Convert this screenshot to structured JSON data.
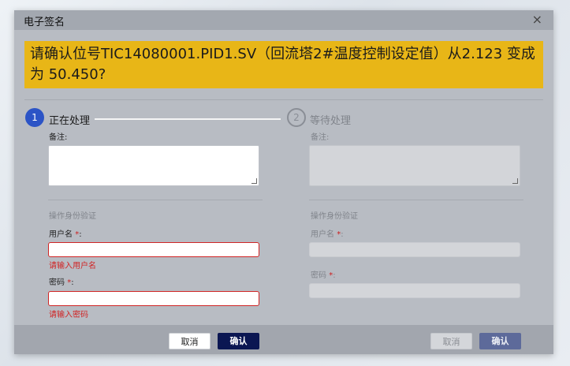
{
  "dialog": {
    "title": "电子签名",
    "close_icon": "×"
  },
  "banner": {
    "text": "请确认位号TIC14080001.PID1.SV（回流塔2#温度控制设定值）从2.123 变成为 50.450?"
  },
  "steps": [
    {
      "number": "1",
      "label": "正在处理"
    },
    {
      "number": "2",
      "label": "等待处理"
    }
  ],
  "left": {
    "remark_label": "备注:",
    "auth_title": "操作身份验证",
    "username_label": "用户名",
    "password_label": "密码",
    "required_mark": "*",
    "colon": ":",
    "username_error": "请输入用户名",
    "password_error": "请输入密码"
  },
  "right": {
    "remark_label": "备注:",
    "auth_title": "操作身份验证",
    "username_label": "用户名",
    "password_label": "密码",
    "required_mark": "*",
    "colon": ":"
  },
  "footer": {
    "left_cancel": "取消",
    "left_confirm": "确认",
    "right_cancel": "取消",
    "right_confirm": "确认"
  },
  "colors": {
    "banner": "#e8b617",
    "active_step": "#2c54c6",
    "confirm": "#0b1652",
    "error": "#d12424"
  }
}
